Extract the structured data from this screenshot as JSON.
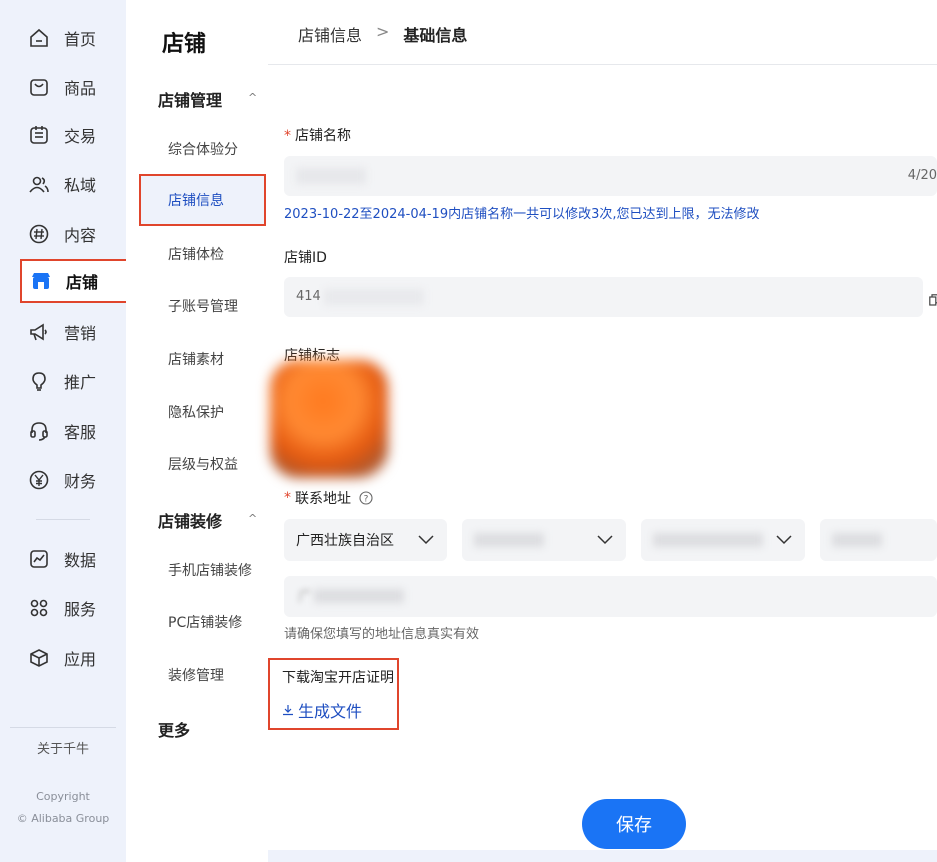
{
  "nav": {
    "items": [
      {
        "label": "首页",
        "icon": "home-icon"
      },
      {
        "label": "商品",
        "icon": "bag-icon"
      },
      {
        "label": "交易",
        "icon": "receipt-icon"
      },
      {
        "label": "私域",
        "icon": "users-icon"
      },
      {
        "label": "内容",
        "icon": "hashtag-icon"
      },
      {
        "label": "店铺",
        "icon": "store-icon"
      },
      {
        "label": "营销",
        "icon": "megaphone-icon"
      },
      {
        "label": "推广",
        "icon": "bulb-icon"
      },
      {
        "label": "客服",
        "icon": "headset-icon"
      },
      {
        "label": "财务",
        "icon": "yen-icon"
      },
      {
        "label": "数据",
        "icon": "chart-icon"
      },
      {
        "label": "服务",
        "icon": "grid-icon"
      },
      {
        "label": "应用",
        "icon": "cube-icon"
      }
    ],
    "active": "店铺",
    "about": "关于千牛",
    "copyright_line1": "Copyright",
    "copyright_line2": "© Alibaba Group"
  },
  "sub_nav": {
    "title": "店铺",
    "groups": [
      {
        "label": "店铺管理",
        "items": [
          "综合体验分",
          "店铺信息",
          "店铺体检",
          "子账号管理",
          "店铺素材",
          "隐私保护",
          "层级与权益"
        ]
      },
      {
        "label": "店铺装修",
        "items": [
          "手机店铺装修",
          "PC店铺装修",
          "装修管理"
        ]
      },
      {
        "label": "更多"
      }
    ],
    "active": "店铺信息",
    "caret": "^"
  },
  "breadcrumb": {
    "parent": "店铺信息",
    "separator": ">",
    "current": "基础信息"
  },
  "form": {
    "shop_name": {
      "label": "店铺名称",
      "required_mark": "*",
      "counter": "4/20"
    },
    "shop_name_hint": "2023-10-22至2024-04-19内店铺名称一共可以修改3次,您已达到上限，无法修改",
    "shop_id": {
      "label": "店铺ID",
      "value_prefix": "414"
    },
    "logo": {
      "label": "店铺标志"
    },
    "address": {
      "label": "联系地址",
      "required_mark": "*",
      "province": "广西壮族自治区",
      "detail_prefix": "广",
      "hint": "请确保您填写的地址信息真实有效"
    },
    "download": {
      "label": "下载淘宝开店证明",
      "link": "生成文件"
    },
    "save": "保存"
  },
  "colors": {
    "accent": "#1a74f5",
    "link": "#1f4fc1",
    "highlight_box": "#e0452c",
    "nav_bg": "#eef2fb"
  }
}
